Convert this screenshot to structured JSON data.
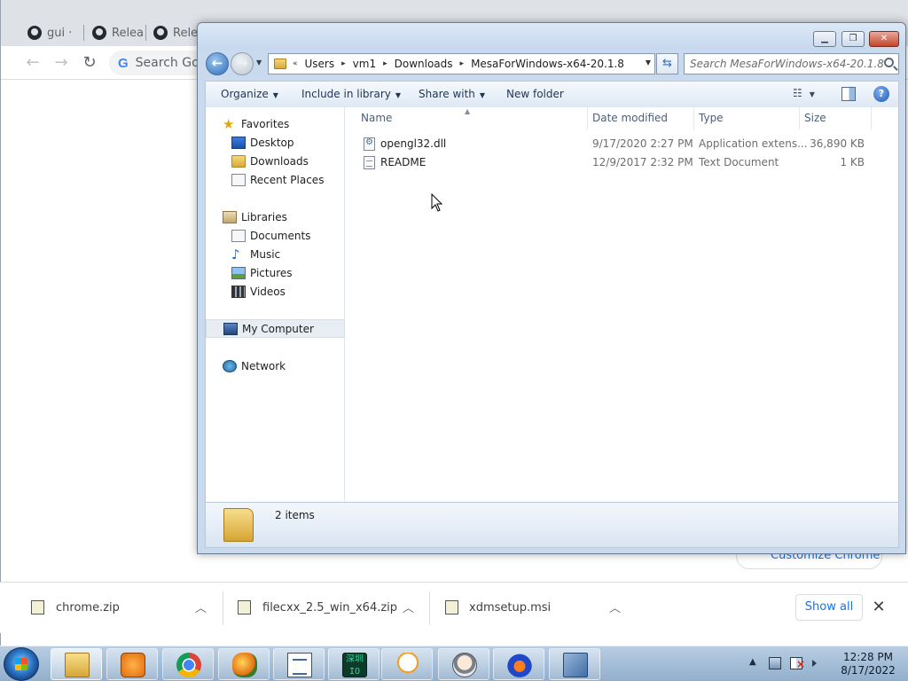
{
  "chrome": {
    "tabs": [
      {
        "label": "gui ·"
      },
      {
        "label": "Relea"
      },
      {
        "label": "Relea"
      }
    ],
    "omnibox_placeholder": "Search Goo",
    "customize_label": "Customize Chrome"
  },
  "explorer": {
    "breadcrumbs": [
      "Users",
      "vm1",
      "Downloads",
      "MesaForWindows-x64-20.1.8"
    ],
    "overflow_glyph": "«",
    "search_placeholder": "Search MesaForWindows-x64-20.1.8",
    "commands": {
      "organize": "Organize",
      "include_in_library": "Include in library",
      "share_with": "Share with",
      "new_folder": "New folder"
    },
    "nav_pane": {
      "favorites": "Favorites",
      "favorites_items": [
        "Desktop",
        "Downloads",
        "Recent Places"
      ],
      "libraries": "Libraries",
      "libraries_items": [
        "Documents",
        "Music",
        "Pictures",
        "Videos"
      ],
      "computer": "My Computer",
      "network": "Network"
    },
    "columns": {
      "name": "Name",
      "date_modified": "Date modified",
      "type": "Type",
      "size": "Size"
    },
    "files": [
      {
        "name": "opengl32.dll",
        "date": "9/17/2020 2:27 PM",
        "type": "Application extens...",
        "size": "36,890 KB",
        "icon": "dll-file-icon"
      },
      {
        "name": "README",
        "date": "12/9/2017 2:32 PM",
        "type": "Text Document",
        "size": "1 KB",
        "icon": "text-file-icon"
      }
    ],
    "details": {
      "item_count": "2 items"
    }
  },
  "downloads": {
    "items": [
      {
        "filename": "chrome.zip"
      },
      {
        "filename": "filecxx_2.5_win_x64.zip"
      },
      {
        "filename": "xdmsetup.msi"
      }
    ],
    "show_all": "Show all"
  },
  "taskbar": {
    "clock_time": "12:28 PM",
    "clock_date": "8/17/2022",
    "io_icon_text": "深圳\nIO"
  }
}
